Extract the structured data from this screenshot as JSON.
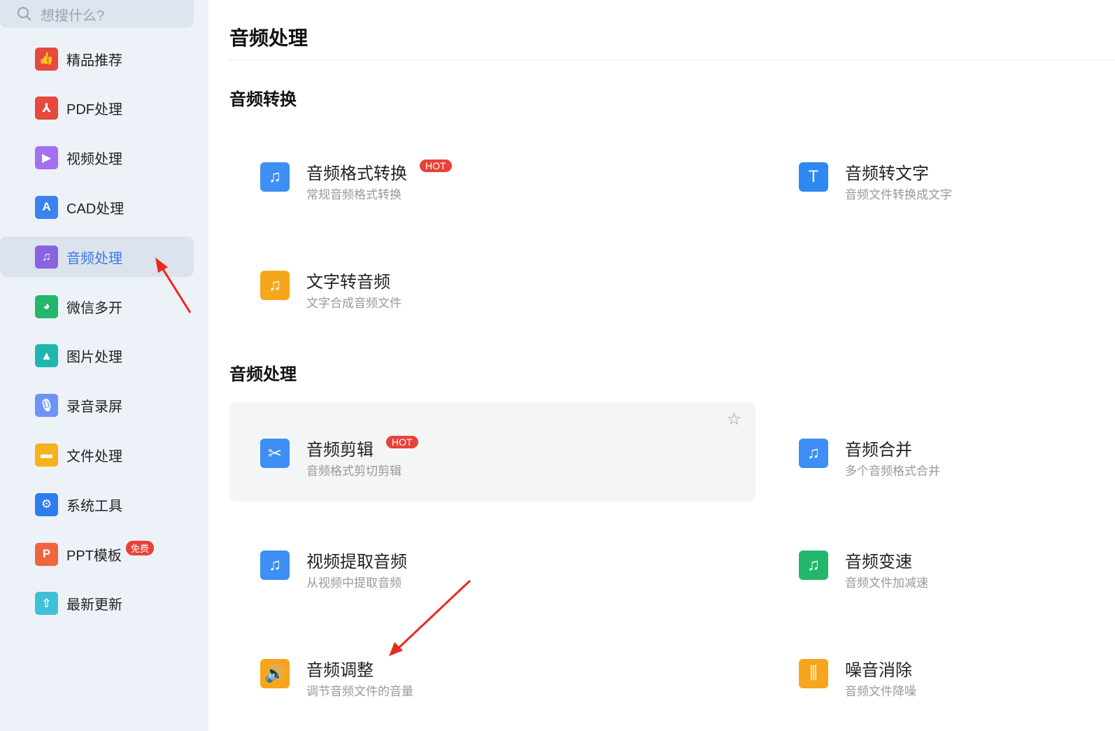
{
  "search": {
    "placeholder": "想搜什么?"
  },
  "sidebar": {
    "items": [
      {
        "label": "精品推荐",
        "icon": "thumbs-up-icon",
        "color": "#e5493f"
      },
      {
        "label": "PDF处理",
        "icon": "pdf-icon",
        "color": "#e5493f"
      },
      {
        "label": "视频处理",
        "icon": "play-icon",
        "color": "#a66ef0"
      },
      {
        "label": "CAD处理",
        "icon": "cad-icon",
        "color": "#3b82f0"
      },
      {
        "label": "音频处理",
        "icon": "music-icon",
        "color": "#8a63e0",
        "active": true
      },
      {
        "label": "微信多开",
        "icon": "wechat-icon",
        "color": "#22b76a"
      },
      {
        "label": "图片处理",
        "icon": "image-icon",
        "color": "#1fb6b0"
      },
      {
        "label": "录音录屏",
        "icon": "microphone-icon",
        "color": "#6f93f5"
      },
      {
        "label": "文件处理",
        "icon": "folder-icon",
        "color": "#f6b11c"
      },
      {
        "label": "系统工具",
        "icon": "gear-icon",
        "color": "#2d7cf0"
      },
      {
        "label": "PPT模板",
        "icon": "ppt-icon",
        "color": "#f0643f",
        "badge": "免费"
      },
      {
        "label": "最新更新",
        "icon": "upload-icon",
        "color": "#3fc0d8"
      }
    ]
  },
  "main": {
    "title": "音频处理",
    "sections": [
      {
        "title": "音频转换",
        "tools": [
          {
            "name": "音频格式转换",
            "desc": "常规音频格式转换",
            "badge": "HOT",
            "color": "#3d8ef5"
          },
          {
            "name": "音频转文字",
            "desc": "音频文件转换成文字",
            "color": "#2f87f0"
          },
          {
            "name": "文字转音频",
            "desc": "文字合成音频文件",
            "color": "#f7a51c"
          }
        ]
      },
      {
        "title": "音频处理",
        "tools": [
          {
            "name": "音频剪辑",
            "desc": "音频格式剪切剪辑",
            "badge": "HOT",
            "color": "#3d8ef5"
          },
          {
            "name": "音频合并",
            "desc": "多个音频格式合并",
            "color": "#3d8ef5"
          },
          {
            "name": "视频提取音频",
            "desc": "从视频中提取音频",
            "color": "#3d8ef5"
          },
          {
            "name": "音频变速",
            "desc": "音频文件加减速",
            "color": "#22b76a"
          },
          {
            "name": "音频调整",
            "desc": "调节音频文件的音量",
            "color": "#f7a51c"
          },
          {
            "name": "噪音消除",
            "desc": "音频文件降噪",
            "color": "#f7a51c"
          }
        ]
      }
    ]
  }
}
